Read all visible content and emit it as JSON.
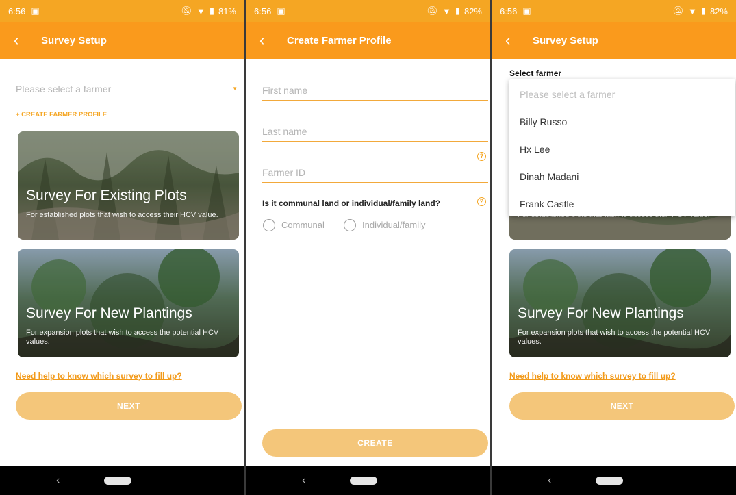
{
  "status": [
    {
      "time": "6:56",
      "battery": "81%"
    },
    {
      "time": "6:56",
      "battery": "82%"
    },
    {
      "time": "6:56",
      "battery": "82%"
    }
  ],
  "screen1": {
    "title": "Survey Setup",
    "farmer_placeholder": "Please select a farmer",
    "create_profile": "+ CREATE FARMER PROFILE",
    "card_existing": {
      "title": "Survey For Existing Plots",
      "desc": "For established plots that wish to access their HCV value."
    },
    "card_new": {
      "title": "Survey For New Plantings",
      "desc": "For expansion plots that wish to access the potential HCV values."
    },
    "help_link": "Need help to know which survey to fill up?",
    "next": "NEXT"
  },
  "screen2": {
    "title": "Create Farmer Profile",
    "first_name": "First name",
    "last_name": "Last name",
    "farmer_id": "Farmer ID",
    "land_question": "Is it communal land or individual/family land?",
    "option_communal": "Communal",
    "option_individual": "Individual/family",
    "create": "CREATE"
  },
  "screen3": {
    "title": "Survey Setup",
    "select_label": "Select farmer",
    "dropdown": {
      "placeholder": "Please select a farmer",
      "options": [
        "Billy Russo",
        "Hx Lee",
        "Dinah Madani",
        "Frank Castle"
      ]
    },
    "card_existing_desc": "For established plots that wish to access their HCV value.",
    "card_new": {
      "title": "Survey For New Plantings",
      "desc": "For expansion plots that wish to access the potential HCV values."
    },
    "help_link": "Need help to know which survey to fill up?",
    "next": "NEXT"
  },
  "colors": {
    "accent": "#fa9a1c",
    "button": "#f4c67a",
    "link": "#f29a1a"
  },
  "icons": [
    "back-arrow-icon",
    "wifi-icon",
    "battery-icon",
    "mute-icon",
    "help-circle-icon",
    "dropdown-arrow-icon",
    "nav-back-icon",
    "nav-home-pill"
  ]
}
